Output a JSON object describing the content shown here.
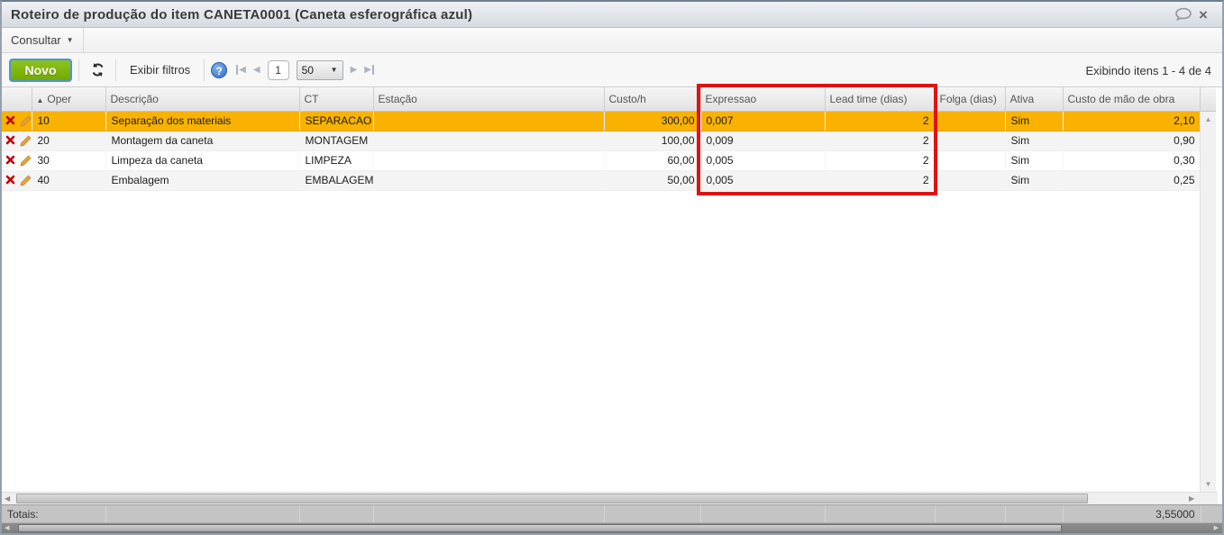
{
  "window": {
    "title": "Roteiro de produção do item CANETA0001 (Caneta esferográfica azul)",
    "close_label": "×"
  },
  "menubar": {
    "consultar_label": "Consultar",
    "caret": "▼"
  },
  "toolbar": {
    "novo_label": "Novo",
    "exibir_filtros_label": "Exibir filtros",
    "help_label": "?",
    "page_value": "1",
    "page_size_value": "50",
    "items_info": "Exibindo itens 1 - 4 de 4",
    "first_icon": "◀",
    "prev_icon": "◀",
    "next_icon": "▶",
    "last_icon": "▶",
    "size_caret": "▼"
  },
  "table": {
    "sort_icon": "▲",
    "columns": [
      "",
      "Oper",
      "Descrição",
      "CT",
      "Estação",
      "Custo/h",
      "Expressao",
      "Lead time (dias)",
      "Folga (dias)",
      "Ativa",
      "Custo de mão de obra"
    ],
    "rows": [
      {
        "oper": "10",
        "descricao": "Separação dos materiais",
        "ct": "SEPARACAO",
        "estacao": "",
        "custo_h": "300,00",
        "expressao": "0,007",
        "lead_time": "2",
        "folga": "",
        "ativa": "Sim",
        "custo_mao": "2,10"
      },
      {
        "oper": "20",
        "descricao": "Montagem da caneta",
        "ct": "MONTAGEM",
        "estacao": "",
        "custo_h": "100,00",
        "expressao": "0,009",
        "lead_time": "2",
        "folga": "",
        "ativa": "Sim",
        "custo_mao": "0,90"
      },
      {
        "oper": "30",
        "descricao": "Limpeza da caneta",
        "ct": "LIMPEZA",
        "estacao": "",
        "custo_h": "60,00",
        "expressao": "0,005",
        "lead_time": "2",
        "folga": "",
        "ativa": "Sim",
        "custo_mao": "0,30"
      },
      {
        "oper": "40",
        "descricao": "Embalagem",
        "ct": "EMBALAGEM",
        "estacao": "",
        "custo_h": "50,00",
        "expressao": "0,005",
        "lead_time": "2",
        "folga": "",
        "ativa": "Sim",
        "custo_mao": "0,25"
      }
    ],
    "totals": {
      "label": "Totais:",
      "custo_mao_total": "3,55000"
    }
  },
  "icons": {
    "comment": "speech-bubble",
    "refresh": "circular-arrows",
    "delete": "red-x",
    "edit": "orange-pencil"
  },
  "colors": {
    "selected_row": "#F9B200",
    "highlight_box": "#E11212",
    "novo_button": "#7DB40E",
    "help_icon": "#3A7AD9"
  },
  "scrollbars": {
    "up_icon": "▲",
    "down_icon": "▼",
    "left_icon": "◀",
    "right_icon": "▶"
  }
}
